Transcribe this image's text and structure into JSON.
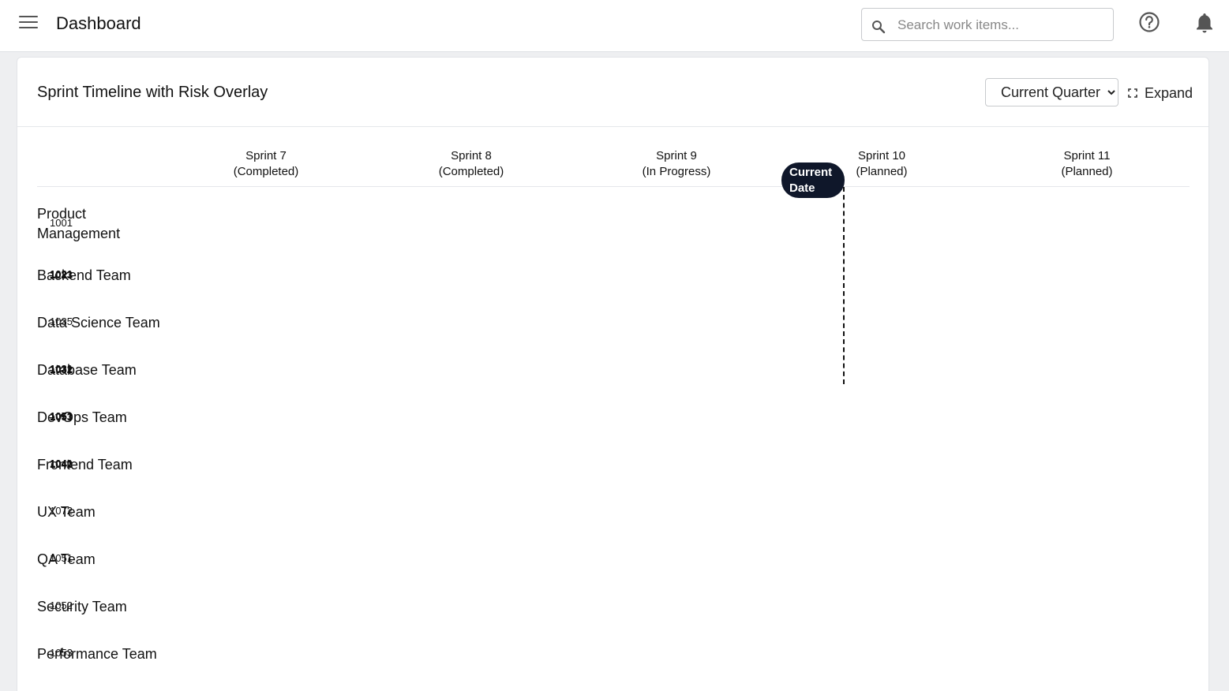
{
  "header": {
    "title": "Dashboard",
    "search_placeholder": "Search work items..."
  },
  "card": {
    "title": "Sprint Timeline with Risk Overlay",
    "period_selected": "Current Quarter",
    "expand_label": "Expand"
  },
  "sprints": [
    {
      "name": "Sprint 7",
      "status": "(Completed)"
    },
    {
      "name": "Sprint 8",
      "status": "(Completed)"
    },
    {
      "name": "Sprint 9",
      "status": "(In Progress)"
    },
    {
      "name": "Sprint 10",
      "status": "(Planned)"
    },
    {
      "name": "Sprint 11",
      "status": "(Planned)"
    }
  ],
  "current_date": {
    "line1": "Current",
    "line2": "Date"
  },
  "teams": [
    {
      "name": "Product Management",
      "ids": [
        "1001"
      ]
    },
    {
      "name": "Backend Team",
      "ids": [
        "1021",
        "1023"
      ]
    },
    {
      "name": "Data Science Team",
      "ids": [
        "1035"
      ]
    },
    {
      "name": "Database Team",
      "ids": [
        "1031",
        "1032"
      ]
    },
    {
      "name": "DevOps Team",
      "ids": [
        "1051",
        "1053"
      ]
    },
    {
      "name": "Frontend Team",
      "ids": [
        "1041",
        "1042"
      ]
    },
    {
      "name": "UX Team",
      "ids": [
        "1072"
      ]
    },
    {
      "name": "QA Team",
      "ids": [
        "1051"
      ]
    },
    {
      "name": "Security Team",
      "ids": [
        "1052"
      ]
    },
    {
      "name": "Performance Team",
      "ids": [
        "1053"
      ]
    }
  ]
}
